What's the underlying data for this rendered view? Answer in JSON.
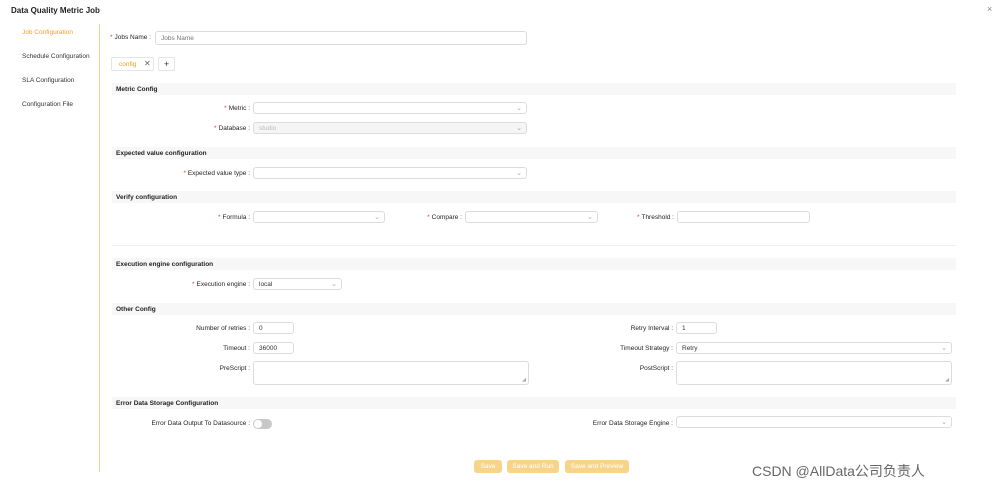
{
  "window": {
    "title": "Data Quality Metric Job",
    "close_symbol": "×"
  },
  "sidebar": {
    "items": [
      {
        "label": "Job Configuration"
      },
      {
        "label": "Schedule Configuration"
      },
      {
        "label": "SLA Configuration"
      },
      {
        "label": "Configuration File"
      }
    ]
  },
  "form": {
    "required_mark": "*",
    "job_name": {
      "label": "Jobs Name :",
      "placeholder": "Jobs Name"
    },
    "tabs": [
      {
        "label": "config"
      }
    ],
    "tab_close": "✕",
    "tab_add": "+",
    "sections": {
      "metric": "Metric Config",
      "expected": "Expected value configuration",
      "verify": "Verify configuration",
      "engine": "Execution engine configuration",
      "other": "Other Config",
      "error": "Error Data Storage Configuration"
    },
    "metric": {
      "label": "Metric :",
      "value": ""
    },
    "database": {
      "label": "Database :",
      "value": "studio"
    },
    "expected_value_type": {
      "label": "Expected value type :",
      "value": ""
    },
    "formula": {
      "label": "Formula :",
      "value": ""
    },
    "compare": {
      "label": "Compare :",
      "value": ""
    },
    "threshold": {
      "label": "Threshold :",
      "value": ""
    },
    "execution_engine": {
      "label": "Execution engine :",
      "value": "local"
    },
    "retries": {
      "label": "Number of retries :",
      "value": "0"
    },
    "retry_interval": {
      "label": "Retry Interval :",
      "value": "1"
    },
    "timeout": {
      "label": "Timeout :",
      "value": "36000"
    },
    "timeout_strategy": {
      "label": "Timeout Strategy :",
      "value": "Retry"
    },
    "prescript": {
      "label": "PreScript :"
    },
    "postscript": {
      "label": "PostScript :"
    },
    "error_output": {
      "label": "Error Data Output To Datasource :",
      "enabled": false
    },
    "error_engine": {
      "label": "Error Data Storage Engine :",
      "value": ""
    }
  },
  "buttons": {
    "save": "Save",
    "save_run": "Save and Run",
    "save_preview": "Save and Preview"
  },
  "watermark": "CSDN @AllData公司负责人",
  "colors": {
    "accent": "#f0a020",
    "required": "#e53935",
    "button_disabled": "#f7d48a"
  }
}
